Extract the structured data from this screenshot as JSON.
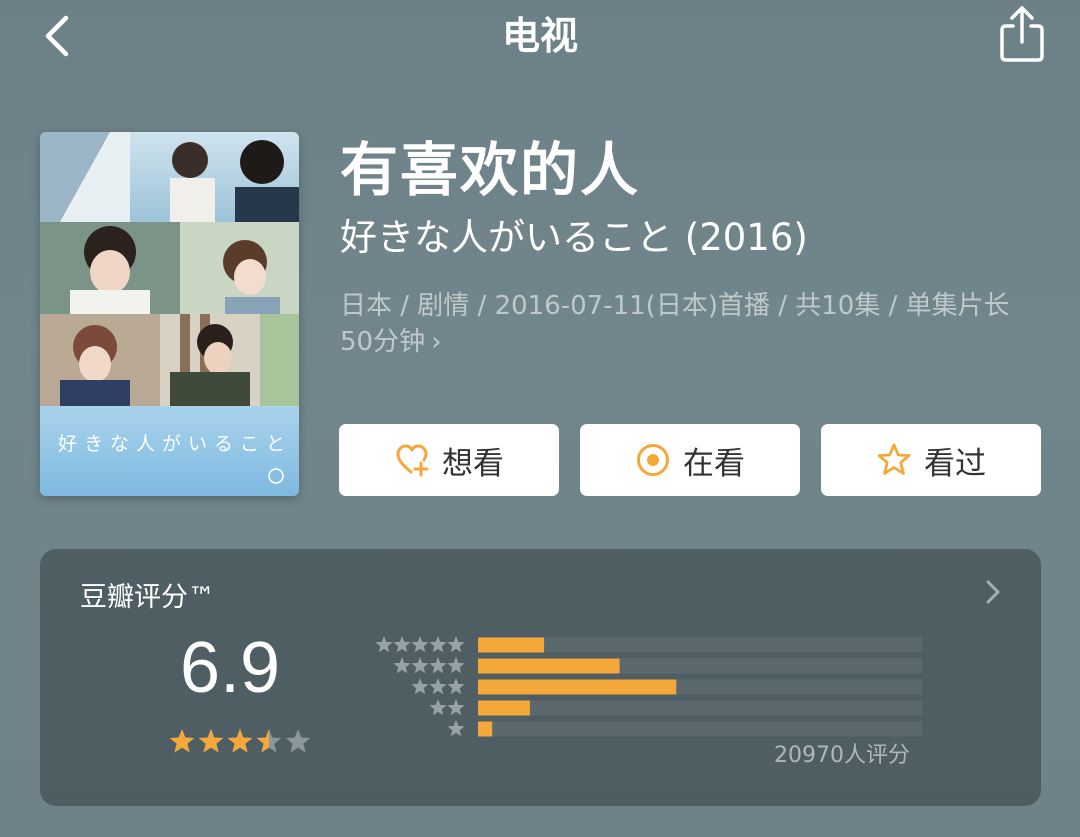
{
  "nav": {
    "title": "电视",
    "back_icon": "chevron-left-icon",
    "share_icon": "share-icon"
  },
  "poster": {
    "caption": "好きな人がいること"
  },
  "subject": {
    "title": "有喜欢的人",
    "original_title": "好きな人がいること (2016)",
    "meta": "日本 / 剧情 / 2016-07-11(日本)首播 / 共10集 / 单集片长50分钟",
    "meta_chevron": "›"
  },
  "actions": [
    {
      "label": "想看",
      "icon": "heart-plus-icon"
    },
    {
      "label": "在看",
      "icon": "target-icon"
    },
    {
      "label": "看过",
      "icon": "star-outline-icon"
    }
  ],
  "rating": {
    "title": "豆瓣评分™",
    "score": "6.9",
    "stars_value": 3.5,
    "stars_max": 5,
    "count_label": "20970人评分",
    "accent": "#f5a83a",
    "distribution": [
      {
        "stars": 5,
        "fraction": 0.14
      },
      {
        "stars": 4,
        "fraction": 0.3
      },
      {
        "stars": 3,
        "fraction": 0.42
      },
      {
        "stars": 2,
        "fraction": 0.11
      },
      {
        "stars": 1,
        "fraction": 0.03
      }
    ]
  }
}
